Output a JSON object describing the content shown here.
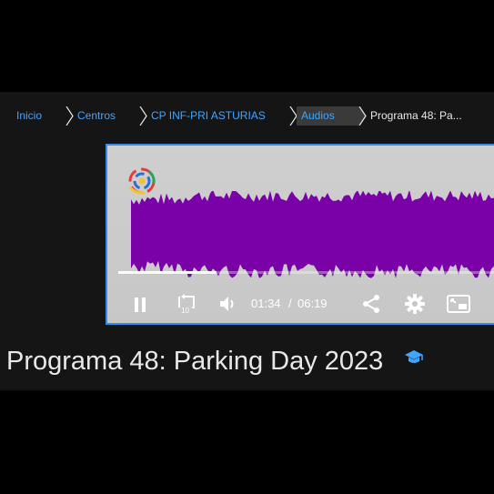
{
  "breadcrumb": {
    "items": [
      {
        "label": "Inicio"
      },
      {
        "label": "Centros"
      },
      {
        "label": "CP INF-PRI ASTURIAS"
      },
      {
        "label": "Audios"
      },
      {
        "label": "Programa 48: Pa..."
      }
    ]
  },
  "player": {
    "current_time": "01:34",
    "separator": "/",
    "duration": "06:19",
    "progress_fraction": 0.25,
    "waveform_color": "#7a00a8",
    "icons": [
      "pause-icon",
      "replay-10-icon",
      "volume-icon",
      "share-icon",
      "settings-icon",
      "picture-in-picture-icon"
    ]
  },
  "page": {
    "title": "Programa 48: Parking Day 2023",
    "title_icon": "graduation-cap-icon"
  },
  "colors": {
    "accent": "#3ea6ff",
    "player_border": "#2f8df3",
    "title_icon": "#3ea6ff"
  }
}
